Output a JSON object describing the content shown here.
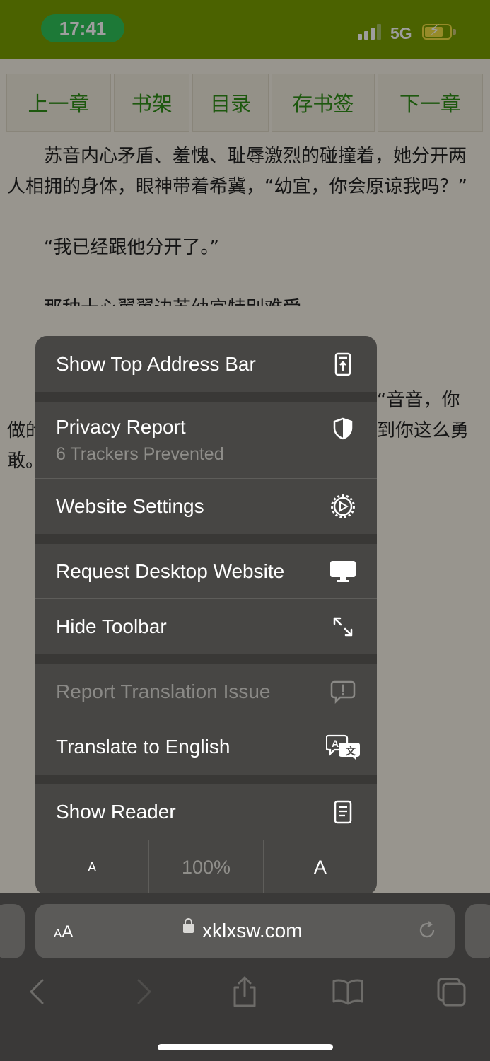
{
  "status_bar": {
    "time": "17:41",
    "network": "5G"
  },
  "chapter_nav": [
    {
      "label": "上一章"
    },
    {
      "label": "书架"
    },
    {
      "label": "目录"
    },
    {
      "label": "存书签"
    },
    {
      "label": "下一章"
    }
  ],
  "article": {
    "paragraphs": [
      "苏音内心矛盾、羞愧、耻辱激烈的碰撞着，她分开两人相拥的身体，眼神带着希冀，“幼宜，你会原谅我吗？”",
      "“我已经跟他分开了。”",
      "那种十心翼翼边苏幼宜特别难受",
      "“音音，你",
      "做的",
      "到你这么勇",
      "敢。"
    ]
  },
  "menu": {
    "show_top_address_bar": "Show Top Address Bar",
    "privacy_report": "Privacy Report",
    "trackers_prevented": "6 Trackers Prevented",
    "website_settings": "Website Settings",
    "request_desktop_website": "Request Desktop Website",
    "hide_toolbar": "Hide Toolbar",
    "report_translation_issue": "Report Translation Issue",
    "translate_to_english": "Translate to English",
    "show_reader": "Show Reader",
    "zoom_small": "A",
    "zoom_level": "100%",
    "zoom_large": "A"
  },
  "toolbar": {
    "aa_label_small": "A",
    "aa_label_large": "A",
    "url": "xklxsw.com"
  }
}
